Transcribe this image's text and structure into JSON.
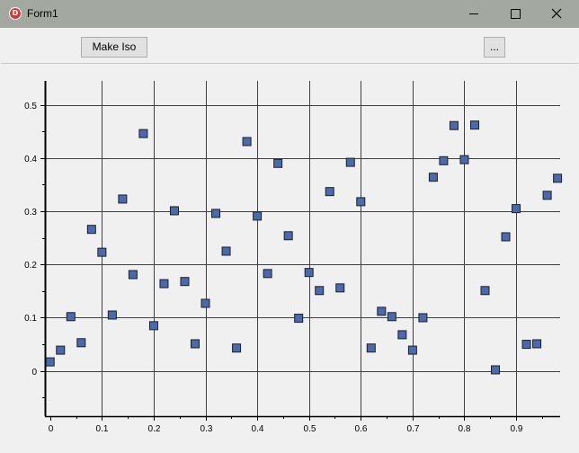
{
  "window": {
    "title": "Form1",
    "icon": "delphi-app-icon"
  },
  "toolbar": {
    "make_iso_label": "Make Iso",
    "more_label": "..."
  },
  "colors": {
    "marker_fill": "#4a6aaa",
    "marker_stroke": "#1a2030",
    "grid": "#404040",
    "titlebar": "#a3a9a1"
  },
  "chart_data": {
    "type": "scatter",
    "title": "",
    "xlabel": "",
    "ylabel": "",
    "xlim": [
      -0.01,
      0.985
    ],
    "ylim": [
      -0.085,
      0.545
    ],
    "xticks": [
      "0",
      "0.1",
      "0.2",
      "0.3",
      "0.4",
      "0.5",
      "0.6",
      "0.7",
      "0.8",
      "0.9"
    ],
    "yticks": [
      "0",
      "0.1",
      "0.2",
      "0.3",
      "0.4",
      "0.5"
    ],
    "grid": true,
    "x": [
      0,
      0.02,
      0.04,
      0.06,
      0.08,
      0.1,
      0.12,
      0.14,
      0.16,
      0.18,
      0.2,
      0.22,
      0.24,
      0.26,
      0.28,
      0.3,
      0.32,
      0.34,
      0.36,
      0.38,
      0.4,
      0.42,
      0.44,
      0.46,
      0.48,
      0.5,
      0.52,
      0.54,
      0.56,
      0.58,
      0.6,
      0.62,
      0.64,
      0.66,
      0.68,
      0.7,
      0.72,
      0.74,
      0.76,
      0.78,
      0.8,
      0.82,
      0.84,
      0.86,
      0.88,
      0.9,
      0.92,
      0.94,
      0.96,
      0.98
    ],
    "y": [
      0.017,
      0.039,
      0.102,
      0.053,
      0.266,
      0.223,
      0.105,
      0.323,
      0.181,
      0.446,
      0.085,
      0.164,
      0.301,
      0.168,
      0.051,
      0.127,
      0.296,
      0.225,
      0.043,
      0.431,
      0.291,
      0.183,
      0.39,
      0.254,
      0.099,
      0.185,
      0.151,
      0.337,
      0.156,
      0.392,
      0.318,
      0.043,
      0.112,
      0.102,
      0.068,
      0.039,
      0.1,
      0.364,
      0.395,
      0.461,
      0.397,
      0.462,
      0.151,
      0.002,
      0.252,
      0.305,
      0.05,
      0.051,
      0.33,
      0.362
    ]
  }
}
